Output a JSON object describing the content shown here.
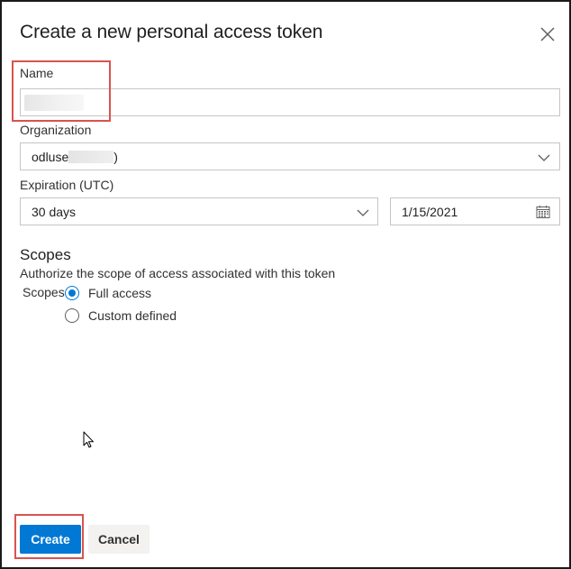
{
  "dialog": {
    "title": "Create a new personal access token"
  },
  "name_field": {
    "label": "Name",
    "value": ""
  },
  "organization_field": {
    "label": "Organization",
    "value_prefix": "odluse",
    "value_suffix": ")"
  },
  "expiration_field": {
    "label": "Expiration (UTC)",
    "selected": "30 days",
    "date": "1/15/2021"
  },
  "scopes": {
    "heading": "Scopes",
    "description": "Authorize the scope of access associated with this token",
    "side_label": "Scopes",
    "options": [
      {
        "label": "Full access",
        "checked": true
      },
      {
        "label": "Custom defined",
        "checked": false
      }
    ]
  },
  "buttons": {
    "create": "Create",
    "cancel": "Cancel"
  },
  "colors": {
    "accent": "#0078d4",
    "highlight": "#d9534f"
  },
  "icons": {
    "close": "close-icon",
    "chevron": "chevron-down-icon",
    "calendar": "calendar-icon",
    "cursor": "mouse-pointer-icon"
  }
}
